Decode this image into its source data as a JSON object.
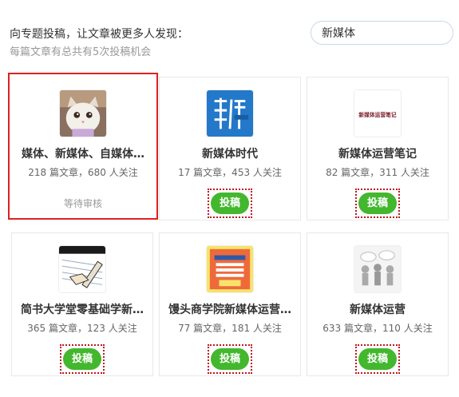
{
  "intro": {
    "title": "向专题投稿，让文章被更多人发现：",
    "subtitle": "每篇文章有总共有5次投稿机会"
  },
  "search": {
    "value": "新媒体"
  },
  "accent_colors": {
    "submit_button": "#43b72e",
    "selected_border": "#e02020",
    "dotted_focus": "#c0171c"
  },
  "collections": [
    {
      "name": "媒体、新媒体、自媒体…",
      "stats": "218 篇文章，680 人关注",
      "status": "等待审核",
      "avatar": "cat-photo",
      "selected": true
    },
    {
      "name": "新媒体时代",
      "stats": "17 篇文章，453 人关注",
      "button": "投稿",
      "avatar": "xin-mei-ti-logo"
    },
    {
      "name": "新媒体运营笔记",
      "stats": "82 篇文章，311 人关注",
      "button": "投稿",
      "avatar": "text-logo",
      "logo_text": "新媒体运营笔记"
    },
    {
      "name": "简书大学堂零基础学新…",
      "stats": "365 篇文章，123 人关注",
      "button": "投稿",
      "avatar": "notebook-illustration"
    },
    {
      "name": "馒头商学院新媒体运营…",
      "stats": "77 篇文章，181 人关注",
      "button": "投稿",
      "avatar": "poster-illustration"
    },
    {
      "name": "新媒体运营",
      "stats": "633 篇文章，110 人关注",
      "button": "投稿",
      "avatar": "people-illustration"
    }
  ]
}
